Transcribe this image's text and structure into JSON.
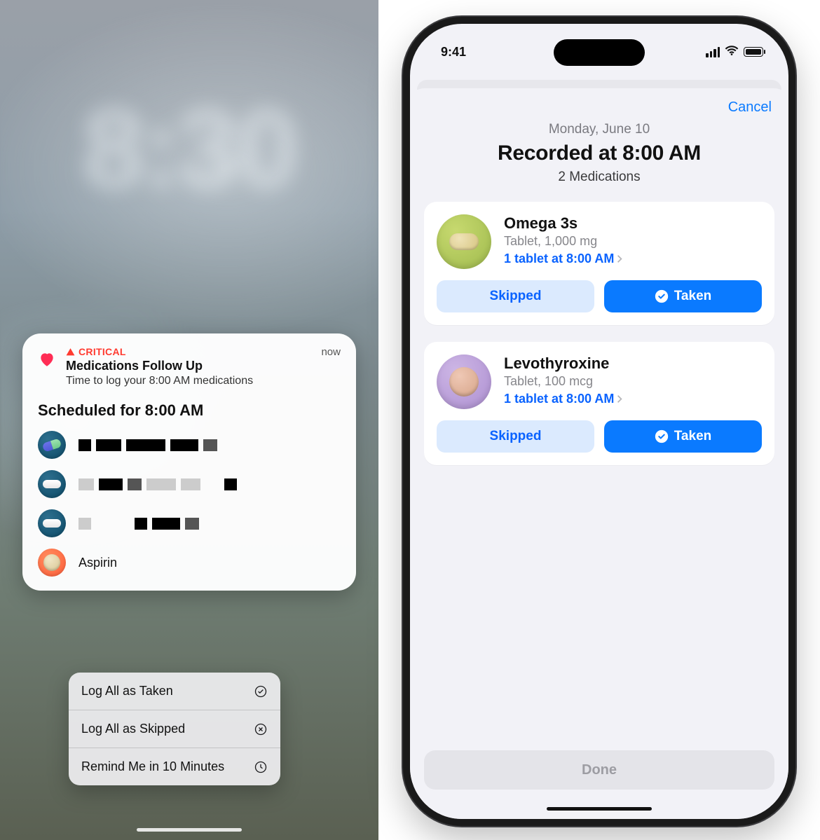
{
  "left": {
    "lock_time": "8:30",
    "notif": {
      "critical_label": "CRITICAL",
      "title": "Medications Follow Up",
      "subtitle": "Time to log your 8:00 AM medications",
      "timestamp": "now",
      "schedule_heading": "Scheduled for 8:00 AM",
      "meds": [
        {
          "icon": "capsule",
          "label_redacted": true,
          "label": ""
        },
        {
          "icon": "pill",
          "label_redacted": true,
          "label": ""
        },
        {
          "icon": "pill",
          "label_redacted": true,
          "label": ""
        },
        {
          "icon": "tablet",
          "label_redacted": false,
          "label": "Aspirin"
        }
      ]
    },
    "actions": {
      "log_taken": "Log All as Taken",
      "log_skipped": "Log All as Skipped",
      "remind": "Remind Me in 10 Minutes"
    }
  },
  "right": {
    "status_time": "9:41",
    "cancel": "Cancel",
    "date": "Monday, June 10",
    "title": "Recorded at 8:00 AM",
    "count": "2 Medications",
    "cards": [
      {
        "name": "Omega 3s",
        "form": "Tablet, 1,000 mg",
        "link": "1 tablet at 8:00 AM",
        "skip_label": "Skipped",
        "taken_label": "Taken",
        "badge_bg": "green",
        "badge_shape": "oval"
      },
      {
        "name": "Levothyroxine",
        "form": "Tablet, 100 mcg",
        "link": "1 tablet at 8:00 AM",
        "skip_label": "Skipped",
        "taken_label": "Taken",
        "badge_bg": "purple",
        "badge_shape": "round"
      }
    ],
    "done": "Done"
  }
}
